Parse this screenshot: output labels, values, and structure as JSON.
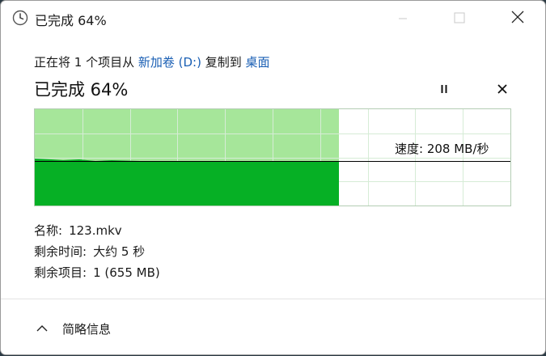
{
  "window": {
    "title": "已完成 64%"
  },
  "copy": {
    "prefix": "正在将 1 个项目从 ",
    "source": "新加卷 (D:)",
    "middle": " 复制到 ",
    "destination": "桌面"
  },
  "status": {
    "headline": "已完成 64%",
    "progress_percent": 64
  },
  "graph": {
    "speed_label": "速度: 208 MB/秒",
    "colors": {
      "completed_bg": "#a6e69a",
      "throughput_fill": "#06b025",
      "grid": "#d6ecd6",
      "speed_line": "#000000"
    }
  },
  "details": {
    "name_key": "名称:",
    "name_value": "123.mkv",
    "time_key": "剩余时间:",
    "time_value": "大约 5 秒",
    "items_key": "剩余项目:",
    "items_value": "1 (655 MB)"
  },
  "footer": {
    "toggle_label": "简略信息"
  },
  "icons": {
    "title": "clock-icon",
    "minimize": "minimize-icon",
    "maximize": "maximize-icon",
    "close": "close-icon",
    "pause": "pause-icon",
    "cancel": "cancel-icon",
    "collapse": "chevron-up-icon"
  }
}
